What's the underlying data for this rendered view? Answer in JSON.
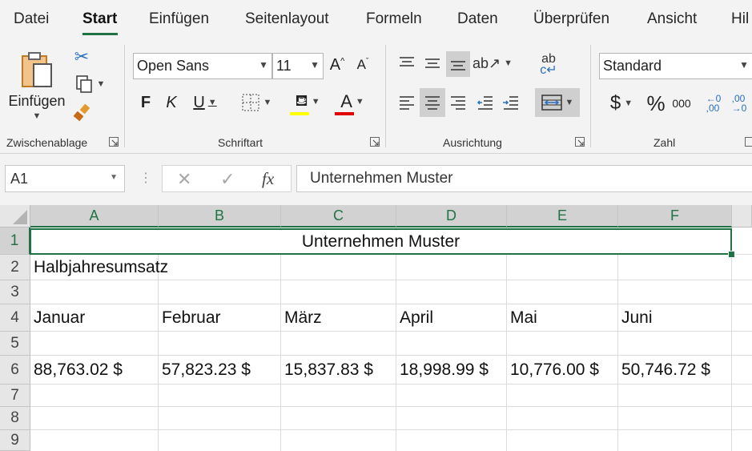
{
  "menu": {
    "tabs": [
      "Datei",
      "Start",
      "Einfügen",
      "Seitenlayout",
      "Formeln",
      "Daten",
      "Überprüfen",
      "Ansicht",
      "Hil"
    ],
    "active": "Start"
  },
  "ribbon": {
    "clipboard": {
      "label": "Zwischenablage",
      "paste_label": "Einfügen"
    },
    "font": {
      "label": "Schriftart",
      "name": "Open Sans",
      "size": "11",
      "bold": "F",
      "italic": "K",
      "underline": "U"
    },
    "alignment": {
      "label": "Ausrichtung"
    },
    "number": {
      "label": "Zahl",
      "format": "Standard",
      "currency": "$",
      "percent": "%",
      "thousands": "000"
    },
    "colors": {
      "highlight": "#ffff00",
      "font_color": "#e00000",
      "accent": "#217346"
    }
  },
  "formula_bar": {
    "name_box": "A1",
    "fx": "fx",
    "content": "Unternehmen Muster"
  },
  "sheet": {
    "columns": [
      "A",
      "B",
      "C",
      "D",
      "E",
      "F"
    ],
    "rows": [
      "1",
      "2",
      "3",
      "4",
      "5",
      "6",
      "7",
      "8",
      "9"
    ],
    "selected_cell": "A1",
    "title": "Unternehmen Muster",
    "subtitle": "Halbjahresumsatz",
    "months": [
      "Januar",
      "Februar",
      "März",
      "April",
      "Mai",
      "Juni"
    ],
    "values": [
      "88,763.02 $",
      "57,823.23 $",
      "15,837.83 $",
      "18,998.99 $",
      "10,776.00 $",
      "50,746.72 $"
    ]
  }
}
